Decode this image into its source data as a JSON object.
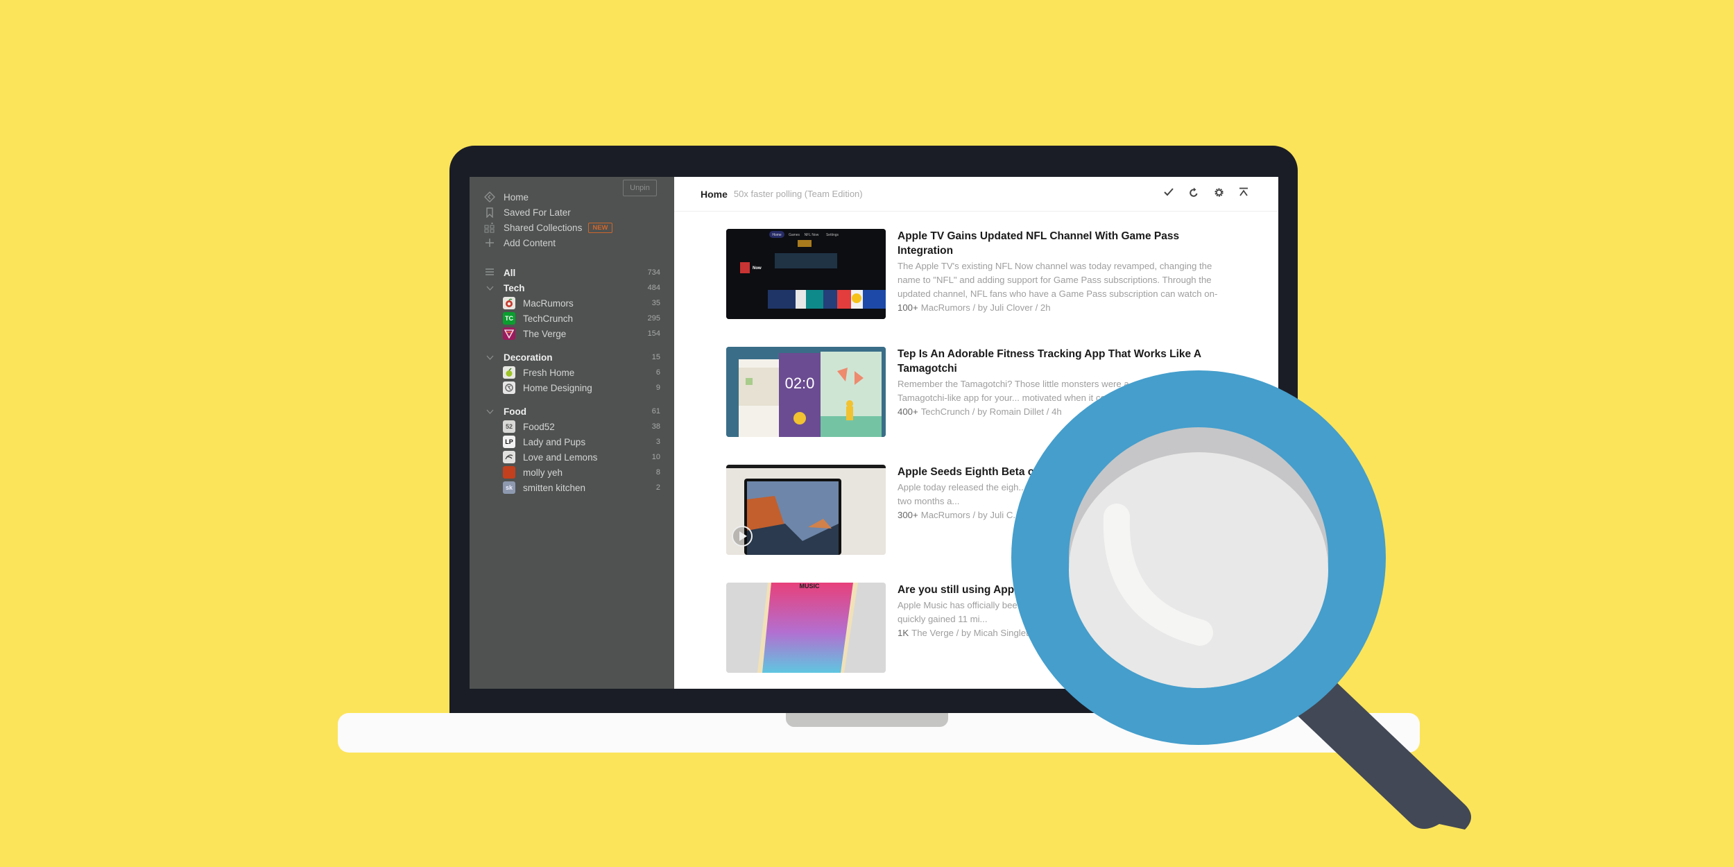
{
  "sidebar": {
    "unpin_label": "Unpin",
    "nav": [
      {
        "label": "Home",
        "icon": "home-icon"
      },
      {
        "label": "Saved For Later",
        "icon": "bookmark-icon"
      },
      {
        "label": "Shared Collections",
        "icon": "collections-icon",
        "badge": "NEW"
      },
      {
        "label": "Add Content",
        "icon": "plus-icon"
      }
    ],
    "all": {
      "label": "All",
      "count": "734"
    },
    "groups": [
      {
        "label": "Tech",
        "count": "484",
        "feeds": [
          {
            "label": "MacRumors",
            "count": "35"
          },
          {
            "label": "TechCrunch",
            "count": "295",
            "favicon": "TC"
          },
          {
            "label": "The Verge",
            "count": "154",
            "favicon": "V"
          }
        ]
      },
      {
        "label": "Decoration",
        "count": "15",
        "feeds": [
          {
            "label": "Fresh Home",
            "count": "6"
          },
          {
            "label": "Home Designing",
            "count": "9"
          }
        ]
      },
      {
        "label": "Food",
        "count": "61",
        "feeds": [
          {
            "label": "Food52",
            "count": "38",
            "favicon": "52"
          },
          {
            "label": "Lady and Pups",
            "count": "3",
            "favicon": "LP"
          },
          {
            "label": "Love and Lemons",
            "count": "10"
          },
          {
            "label": "molly yeh",
            "count": "8"
          },
          {
            "label": "smitten kitchen",
            "count": "2",
            "favicon": "sk"
          }
        ]
      }
    ]
  },
  "header": {
    "title": "Home",
    "subtitle": "50x faster polling (Team Edition)",
    "actions": [
      "mark-read",
      "refresh",
      "settings",
      "collapse"
    ]
  },
  "articles": [
    {
      "title": "Apple TV Gains Updated NFL Channel With Game Pass Integration",
      "summary": "The Apple TV's existing NFL Now channel was today revamped, changing the name to \"NFL\" and adding support for Game Pass subscriptions. Through the updated channel, NFL fans who have a Game Pass subscription can watch on-",
      "engagement": "100+",
      "meta": "MacRumors / by Juli Clover / 2h"
    },
    {
      "title": "Tep Is An Adorable Fitness Tracking App That Works Like A Tamagotchi",
      "summary": "Remember the Tamagotchi? Those little monsters were a... called Tep created a Tamagotchi-like app for your... motivated when it comes to working out. Mov...",
      "engagement": "400+",
      "meta": "TechCrunch / by Romain Dillet / 4h"
    },
    {
      "title": "Apple Seeds Eighth Beta o... Sixth Beta to Public Teste...",
      "summary": "Apple today released the eigh... testing purposes, nearly two ... and more than two months a...",
      "engagement": "300+",
      "meta": "MacRumors / by Juli C..."
    },
    {
      "title": "Are you still using App...",
      "summary": "Apple Music has officially bee... it's had a few ups and downs. ... Music has quickly gained 11 mi...",
      "engagement": "1K",
      "meta": "The Verge / by Micah Singlet..."
    }
  ],
  "thumbnails": {
    "apple_tv_tabs": [
      "Home",
      "Games",
      "NFL Now",
      "Settings"
    ],
    "tep_clock": "02:0",
    "music_label": "MUSIC"
  },
  "colors": {
    "background": "#FCE45A",
    "bezel": "#1B1D26",
    "sidebar": "#4F5251",
    "new_badge": "#D0672B",
    "magnifier_ring": "#459ECC",
    "magnifier_handle": "#424855"
  }
}
